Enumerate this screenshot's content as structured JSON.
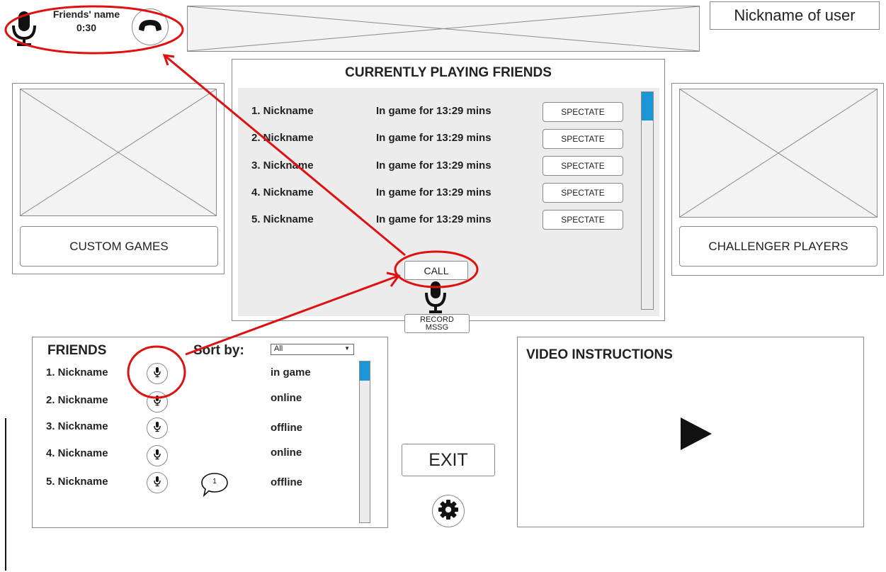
{
  "call_widget": {
    "friend_name": "Friends' name",
    "duration": "0:30"
  },
  "header": {
    "user_nickname": "Nickname of user"
  },
  "currently_playing": {
    "title": "CURRENTLY PLAYING FRIENDS",
    "rows": [
      {
        "name": "1. Nickname",
        "status": "In game for 13:29 mins",
        "action": "SPECTATE"
      },
      {
        "name": "2. Nickname",
        "status": "In game for 13:29 mins",
        "action": "SPECTATE"
      },
      {
        "name": "3. Nickname",
        "status": "In game for 13:29 mins",
        "action": "SPECTATE"
      },
      {
        "name": "4. Nickname",
        "status": "In game for 13:29 mins",
        "action": "SPECTATE"
      },
      {
        "name": "5. Nickname",
        "status": "In game for 13:29 mins",
        "action": "SPECTATE"
      }
    ],
    "call_label": "CALL",
    "record_label_1": "RECORD",
    "record_label_2": "MSSG",
    "scroll_fraction": 0.13
  },
  "left_card": {
    "button_label": "CUSTOM GAMES"
  },
  "right_card": {
    "button_label": "CHALLENGER PLAYERS"
  },
  "friends": {
    "title": "FRIENDS",
    "sort_label": "Sort by:",
    "sort_value": "All",
    "rows": [
      {
        "name": "1. Nickname",
        "status": "in game"
      },
      {
        "name": "2. Nickname",
        "status": "online"
      },
      {
        "name": "3. Nickname",
        "status": "offline"
      },
      {
        "name": "4. Nickname",
        "status": "online"
      },
      {
        "name": "5. Nickname",
        "status": "offline",
        "message_count": "1"
      }
    ],
    "scroll_fraction": 0.12
  },
  "exit_label": "EXIT",
  "video": {
    "title": "VIDEO INSTRUCTIONS"
  },
  "colors": {
    "accent": "#1b95d8",
    "annotation": "#e01010",
    "border": "#8a8a8a",
    "panel_bg": "#ececec"
  },
  "icons": {
    "mic": "microphone-icon",
    "hangup": "phone-hangup-icon",
    "settings": "gear-icon",
    "play": "play-icon",
    "chat": "chat-bubble-icon"
  }
}
